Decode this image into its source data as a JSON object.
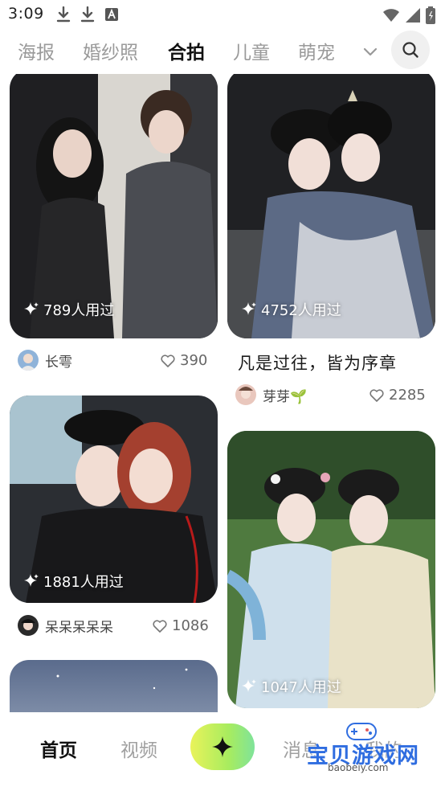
{
  "status_bar": {
    "time": "3:09",
    "left_icons": [
      "download-icon",
      "download-icon",
      "font-icon"
    ],
    "right_icons": [
      "wifi-icon",
      "signal-icon",
      "battery-icon"
    ]
  },
  "tabs": {
    "items": [
      "海报",
      "婚纱照",
      "合拍",
      "儿童",
      "萌宠"
    ],
    "active_index": 2,
    "accent_color": "#c6f36b"
  },
  "feed": {
    "left": [
      {
        "usage": "789人用过",
        "author": "长雩",
        "likes": "390"
      },
      {
        "usage": "1881人用过",
        "author": "呆呆呆呆呆",
        "likes": "1086"
      },
      {
        "usage": ""
      }
    ],
    "right": [
      {
        "usage": "4752人用过",
        "title": "凡是过往，皆为序章",
        "author": "芽芽🌱",
        "likes": "2285"
      },
      {
        "usage": "1047人用过"
      }
    ]
  },
  "bottom_nav": {
    "home": "首页",
    "video": "视频",
    "messages": "消息",
    "mine": "我的",
    "create_icon": "sparkle-icon"
  },
  "watermark": {
    "text": "宝贝游戏网",
    "url": "baobeiy.com"
  }
}
